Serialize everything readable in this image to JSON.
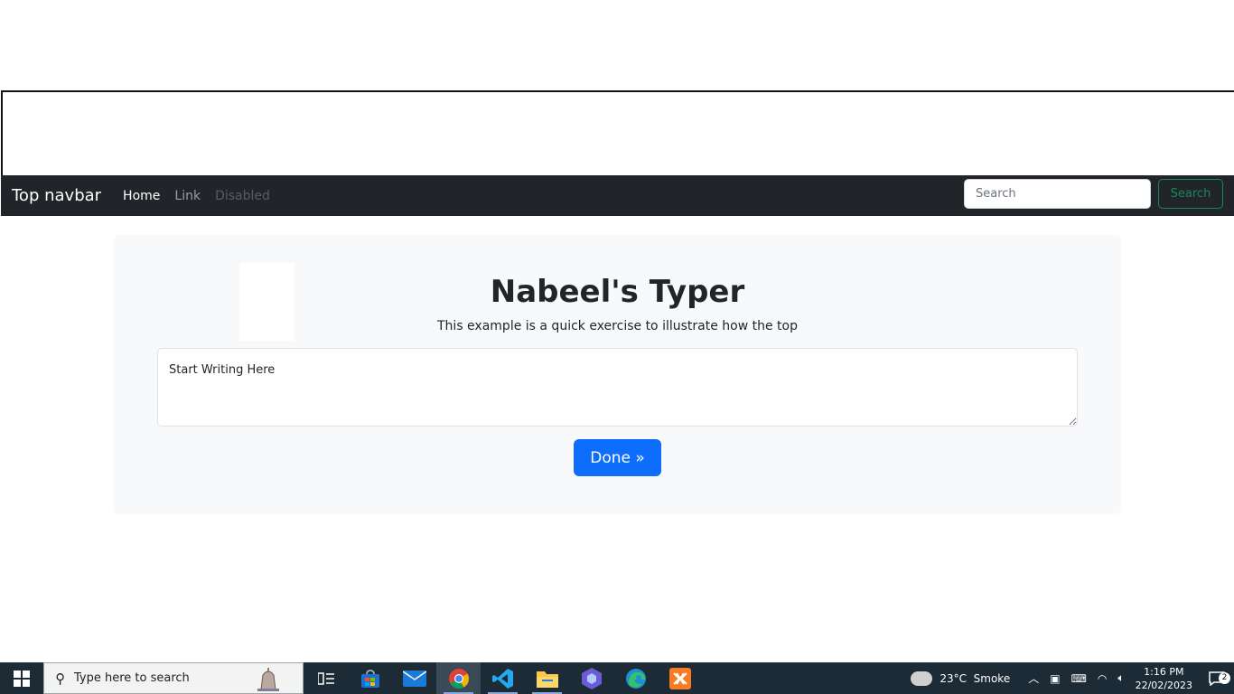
{
  "navbar": {
    "brand": "Top navbar",
    "links": [
      {
        "label": "Home",
        "state": "active"
      },
      {
        "label": "Link",
        "state": "normal"
      },
      {
        "label": "Disabled",
        "state": "disabled"
      }
    ],
    "search_placeholder": "Search",
    "search_button": "Search"
  },
  "main": {
    "title": "Nabeel's Typer",
    "lead": "This example is a quick exercise to illustrate how the top",
    "textarea_value": "Start Writing Here",
    "done_button": "Done »"
  },
  "taskbar": {
    "search_placeholder": "Type here to search",
    "apps": [
      {
        "icon": "task-view-icon"
      },
      {
        "icon": "microsoft-store-icon"
      },
      {
        "icon": "mail-icon"
      },
      {
        "icon": "chrome-icon",
        "active": true
      },
      {
        "icon": "vscode-icon",
        "running": true
      },
      {
        "icon": "file-explorer-icon",
        "running": true
      },
      {
        "icon": "hexagon-app-icon"
      },
      {
        "icon": "edge-icon"
      },
      {
        "icon": "xampp-icon"
      }
    ],
    "weather": "23°C  Smoke",
    "time": "1:16 PM",
    "date": "22/02/2023",
    "notification_count": "2"
  },
  "colors": {
    "navbar_bg": "#212529",
    "primary": "#0d6efd",
    "success": "#198754",
    "jumbotron_bg": "#f8f9fa",
    "taskbar_bg": "#1c2b36"
  }
}
